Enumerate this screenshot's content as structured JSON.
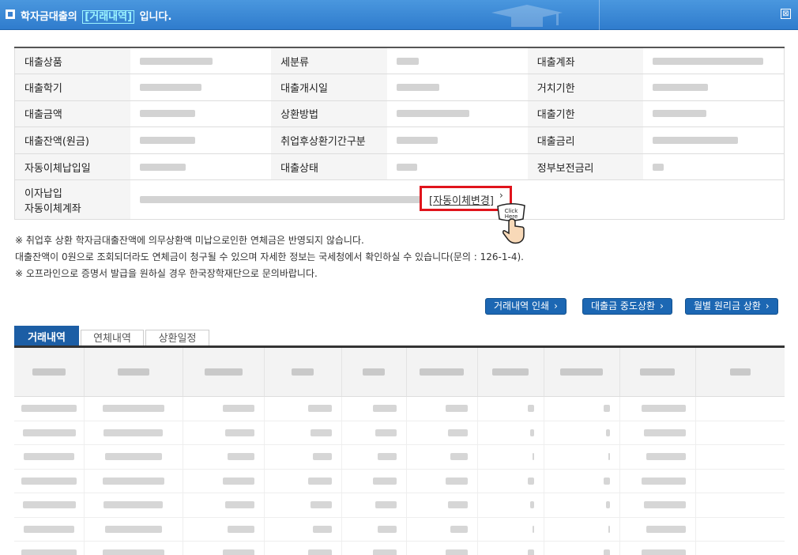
{
  "window": {
    "title_prefix": "학자금대출의",
    "title_highlight": "[거래내역]",
    "title_suffix": "입니다.",
    "close_glyph": "⊠"
  },
  "info_table": {
    "rows": [
      [
        {
          "label": "대출상품"
        },
        {
          "label": "세분류"
        },
        {
          "label": "대출계좌"
        }
      ],
      [
        {
          "label": "대출학기"
        },
        {
          "label": "대출개시일"
        },
        {
          "label": "거치기한"
        }
      ],
      [
        {
          "label": "대출금액"
        },
        {
          "label": "상환방법"
        },
        {
          "label": "대출기한"
        }
      ],
      [
        {
          "label": "대출잔액(원금)"
        },
        {
          "label": "취업후상환기간구분"
        },
        {
          "label": "대출금리"
        }
      ],
      [
        {
          "label": "자동이체납입일"
        },
        {
          "label": "대출상태"
        },
        {
          "label": "정부보전금리"
        }
      ]
    ],
    "last_row_label_line1": "이자납입",
    "last_row_label_line2": "자동이체계좌",
    "auto_transfer_link": "[자동이체변경]",
    "click_here": "Click Here"
  },
  "notes": [
    "※ 취업후 상환 학자금대출잔액에 의무상환액 미납으로인한 연체금은 반영되지 않습니다.",
    "대출잔액이 0원으로 조회되더라도 연체금이 청구될 수 있으며 자세한 정보는 국세청에서 확인하실 수 있습니다(문의 : 126-1-4).",
    "※ 오프라인으로 증명서 발급을 원하실 경우 한국장학재단으로 문의바랍니다."
  ],
  "buttons": {
    "print": "거래내역 인쇄",
    "prepay": "대출금 중도상환",
    "monthly": "월별 원리금 상환",
    "chevron": "›"
  },
  "tabs": [
    "거래내역",
    "연체내역",
    "상환일정"
  ],
  "colors": {
    "titlebar": "#3b88d6",
    "button": "#1c67b3",
    "active_tab": "#1c5ea5",
    "highlight_box": "#e0141c"
  }
}
